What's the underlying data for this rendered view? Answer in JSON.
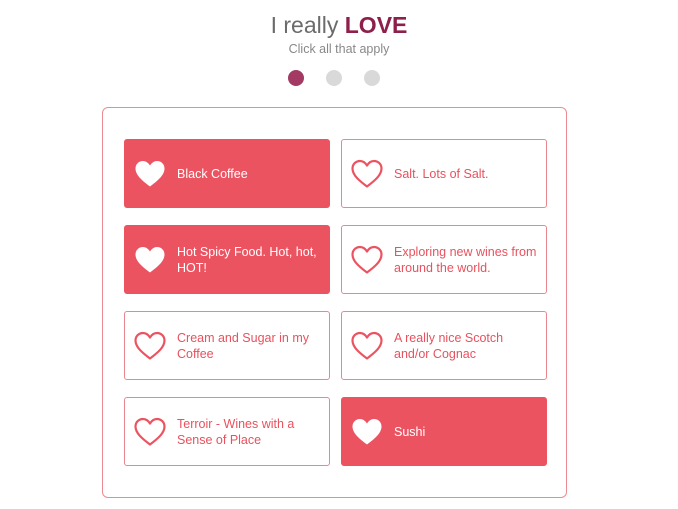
{
  "header": {
    "title_prefix": "I really ",
    "title_emphasis": "LOVE",
    "subtitle": "Click all that apply"
  },
  "progress": {
    "current_step": 1,
    "total_steps": 3
  },
  "colors": {
    "accent": "#ec5361",
    "title_emphasis": "#8d1f4b",
    "active_dot": "#a23a64",
    "inactive_dot": "#d9d9d9"
  },
  "options": [
    {
      "label": "Black Coffee",
      "selected": true,
      "icon": "heart-icon"
    },
    {
      "label": "Salt. Lots of Salt.",
      "selected": false,
      "icon": "heart-outline-icon"
    },
    {
      "label": "Hot Spicy Food. Hot, hot, HOT!",
      "selected": true,
      "icon": "heart-icon"
    },
    {
      "label": "Exploring new wines from around the world.",
      "selected": false,
      "icon": "heart-outline-icon"
    },
    {
      "label": "Cream and Sugar in my Coffee",
      "selected": false,
      "icon": "heart-outline-icon"
    },
    {
      "label": "A really nice Scotch and/or Cognac",
      "selected": false,
      "icon": "heart-outline-icon"
    },
    {
      "label": "Terroir - Wines with a Sense of Place",
      "selected": false,
      "icon": "heart-outline-icon"
    },
    {
      "label": "Sushi",
      "selected": true,
      "icon": "heart-icon"
    }
  ]
}
